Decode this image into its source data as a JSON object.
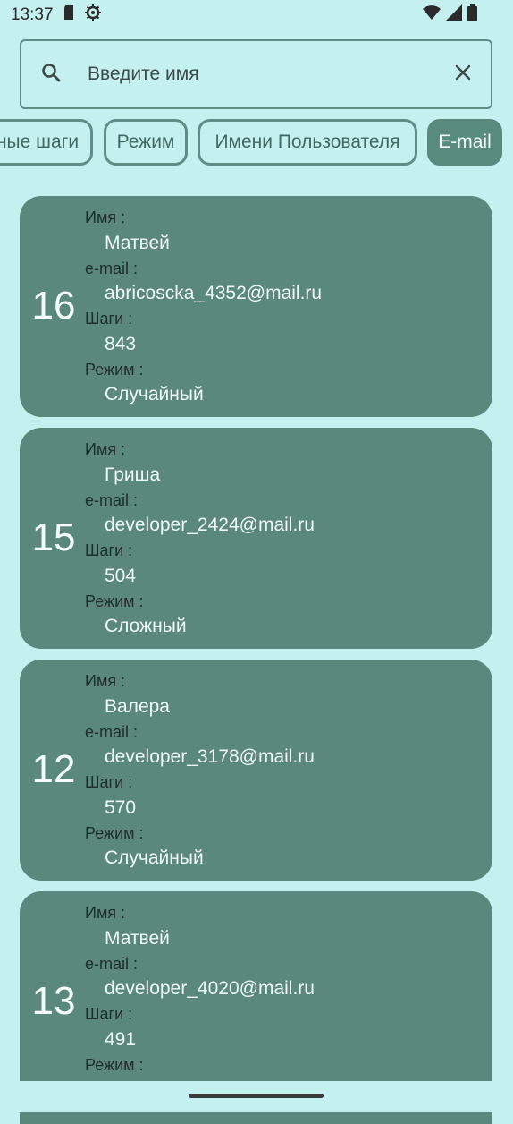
{
  "status": {
    "time": "13:37"
  },
  "search": {
    "placeholder": "Введите имя"
  },
  "chips": [
    "ные шаги",
    "Режим",
    "Имени Пользователя",
    "E-mail"
  ],
  "labels": {
    "name": "Имя :",
    "email": "e-mail :",
    "steps": "Шаги :",
    "mode": "Режим :"
  },
  "cards": [
    {
      "rank": "16",
      "name": "Матвей",
      "email": "abricoscka_4352@mail.ru",
      "steps": "843",
      "mode": "Случайный"
    },
    {
      "rank": "15",
      "name": "Гриша",
      "email": "developer_2424@mail.ru",
      "steps": "504",
      "mode": "Сложный"
    },
    {
      "rank": "12",
      "name": "Валера",
      "email": "developer_3178@mail.ru",
      "steps": "570",
      "mode": "Случайный"
    },
    {
      "rank": "13",
      "name": "Матвей",
      "email": "developer_4020@mail.ru",
      "steps": "491",
      "mode": ""
    }
  ],
  "colors": {
    "background": "#c4f0ef",
    "card": "#5b887c",
    "accent": "#588a7d"
  },
  "icons": [
    "sd-card-icon",
    "settings-icon",
    "wifi-icon",
    "signal-icon",
    "battery-icon",
    "search-icon",
    "close-icon"
  ]
}
